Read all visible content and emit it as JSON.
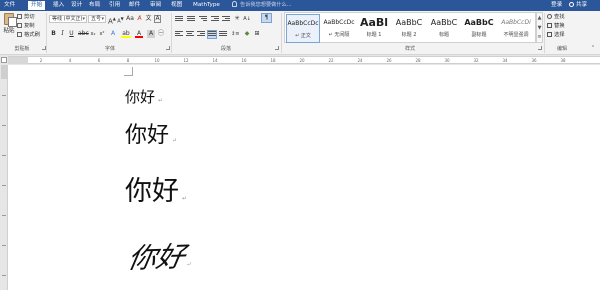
{
  "tabs": [
    "文件",
    "开始",
    "插入",
    "设计",
    "布局",
    "引用",
    "邮件",
    "审阅",
    "视图",
    "MathType"
  ],
  "active_tab": "开始",
  "tell_me_placeholder": "告诉我您想要做什么...",
  "login_label": "登录",
  "share_label": "共享",
  "clipboard": {
    "paste": "粘贴",
    "cut": "剪切",
    "copy": "复制",
    "format_painter": "格式刷",
    "group_label": "剪贴板"
  },
  "font": {
    "font_name": "等线 (中文正)",
    "font_size": "五号",
    "bold": "B",
    "italic": "I",
    "underline": "U",
    "font_color": "A",
    "group_label": "字体"
  },
  "paragraph": {
    "group_label": "段落"
  },
  "styles": {
    "group_label": "样式",
    "items": [
      {
        "sample": "AaBbCcDc",
        "name": "↵ 正文"
      },
      {
        "sample": "AaBbCcDc",
        "name": "↵ 无间隔"
      },
      {
        "sample": "AaBl",
        "name": "标题 1"
      },
      {
        "sample": "AaBbC",
        "name": "标题 2"
      },
      {
        "sample": "AaBbC",
        "name": "标题"
      },
      {
        "sample": "AaBbC",
        "name": "副标题"
      },
      {
        "sample": "AaBbCcDi",
        "name": "不明显强调"
      }
    ]
  },
  "editing": {
    "group_label": "编辑",
    "find": "查找",
    "replace": "替换",
    "select": "选择"
  },
  "ruler_ticks": [
    "2",
    "4",
    "6",
    "8",
    "10",
    "12",
    "14",
    "16",
    "18",
    "20",
    "22",
    "24",
    "26",
    "28",
    "30",
    "32",
    "34",
    "36",
    "38"
  ],
  "document_lines": [
    "你好",
    "你好",
    "你好",
    "你好"
  ]
}
